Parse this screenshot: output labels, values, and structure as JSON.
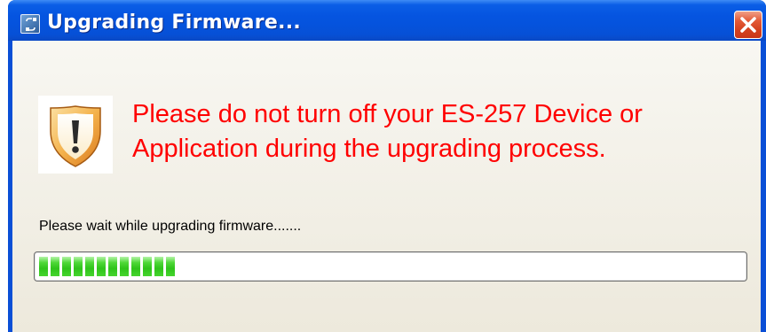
{
  "window": {
    "title": "Upgrading Firmware...",
    "icon": "app-icon",
    "close_icon": "close-icon"
  },
  "message": {
    "icon": "warning-shield-icon",
    "line1": "Please do not turn off your ES-257 Device or",
    "line2": "Application during the upgrading process.",
    "color": "#ff0000"
  },
  "progress": {
    "label": "Please wait while upgrading firmware.......",
    "value_fraction": 0.2,
    "bar_color": "#2fc41a"
  }
}
